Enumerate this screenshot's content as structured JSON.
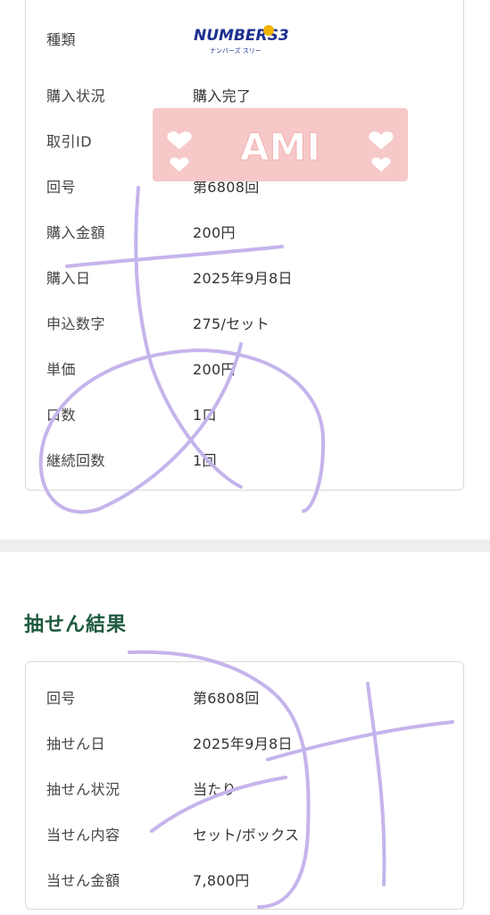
{
  "purchase": {
    "type_label": "種類",
    "logo_text": "NUMBERS3",
    "logo_subtext": "ナンバーズ スリー",
    "rows": [
      {
        "label": "購入状況",
        "value": "購入完了"
      },
      {
        "label": "取引ID",
        "value": ""
      },
      {
        "label": "回号",
        "value": "第6808回"
      },
      {
        "label": "購入金額",
        "value": "200円"
      },
      {
        "label": "購入日",
        "value": "2025年9月8日"
      },
      {
        "label": "申込数字",
        "value": "275/セット"
      },
      {
        "label": "単価",
        "value": "200円"
      },
      {
        "label": "口数",
        "value": "1口"
      },
      {
        "label": "継続回数",
        "value": "1回"
      }
    ]
  },
  "results": {
    "title": "抽せん結果",
    "rows": [
      {
        "label": "回号",
        "value": "第6808回"
      },
      {
        "label": "抽せん日",
        "value": "2025年9月8日"
      },
      {
        "label": "抽せん状況",
        "value": "当たり"
      },
      {
        "label": "当せん内容",
        "value": "セット/ボックス"
      },
      {
        "label": "当せん金額",
        "value": "7,800円"
      }
    ]
  },
  "sticker": {
    "text": "AMI",
    "color": "#f6c8c8"
  },
  "colors": {
    "accent": "#1f5a3f",
    "annotation": "#c5b4ec",
    "border": "#d9d9d9"
  }
}
